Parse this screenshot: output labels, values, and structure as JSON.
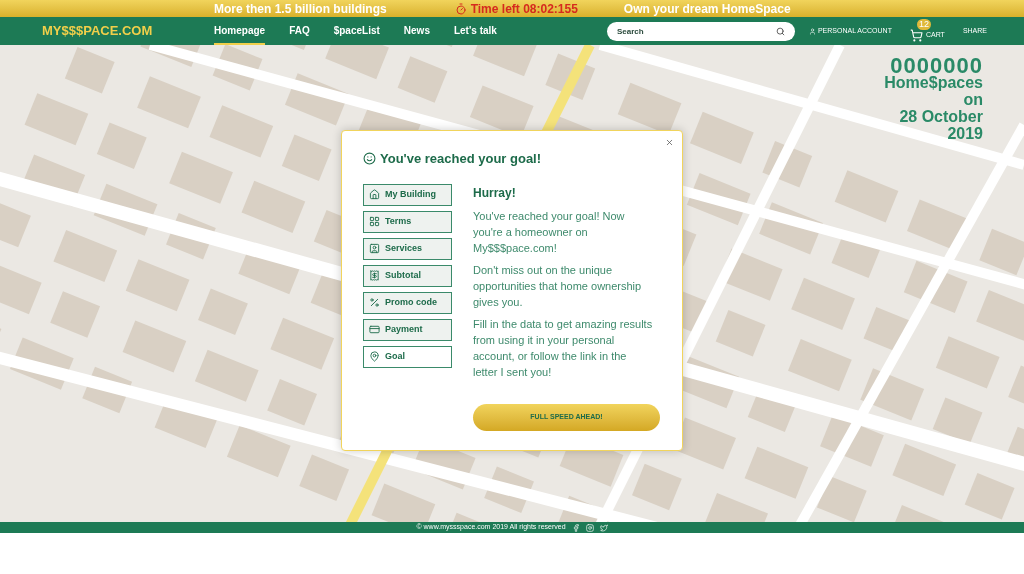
{
  "logo": "MY$$$PACE.COM",
  "top_bar": {
    "left": "More then 1.5 billion buildings",
    "timer": "Time left 08:02:155",
    "right": "Own your dream HomeSpace"
  },
  "nav": [
    {
      "label": "Homepage",
      "selected": true
    },
    {
      "label": "FAQ",
      "selected": false
    },
    {
      "label": "$paceList",
      "selected": false
    },
    {
      "label": "News",
      "selected": false
    },
    {
      "label": "Let's talk",
      "selected": false
    }
  ],
  "search": {
    "placeholder": "Search"
  },
  "account": "PERSONAL ACCOUNT",
  "cart": {
    "label": "CART",
    "count": "12"
  },
  "share": "SHARE",
  "counter": {
    "number": "0000000",
    "lines": [
      "Home$paces",
      "on",
      "28 October",
      "2019"
    ]
  },
  "dialog": {
    "title": "You've reached your goal!",
    "steps": [
      {
        "label": "My Building",
        "kind": "building",
        "selected": false
      },
      {
        "label": "Terms",
        "kind": "terms",
        "selected": false
      },
      {
        "label": "Services",
        "kind": "services",
        "selected": false
      },
      {
        "label": "Subtotal",
        "kind": "subtotal",
        "selected": false
      },
      {
        "label": "Promo code",
        "kind": "promo",
        "selected": false
      },
      {
        "label": "Payment",
        "kind": "payment",
        "selected": false
      },
      {
        "label": "Goal",
        "kind": "goal",
        "selected": true
      }
    ],
    "heading": "Hurray!",
    "paragraphs": [
      "You've reached your goal! Now you're a homeowner on My$$$pace.com!",
      "Don't miss out on the unique opportunities that home ownership gives you.",
      "Fill in the data to get amazing results from using it in your personal account, or follow the link in the letter I sent you!"
    ],
    "button": "FULL SPEED AHEAD!"
  },
  "footer": "© www.myssspace.com 2019 All rights reserved"
}
